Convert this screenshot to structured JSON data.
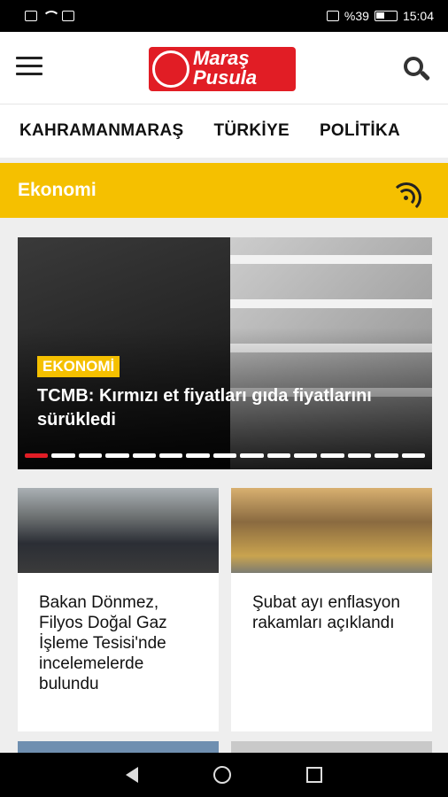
{
  "status_bar": {
    "battery": "%39",
    "time": "15:04"
  },
  "header": {
    "logo_line1": "Maraş",
    "logo_line2": "Pusula"
  },
  "tabs": [
    "KAHRAMANMARAŞ",
    "TÜRKİYE",
    "POLİTİKA"
  ],
  "section": {
    "title": "Ekonomi"
  },
  "hero": {
    "tag": "EKONOMİ",
    "title": "TCMB: Kırmızı et fiyatları gıda fiyatlarını sürükledi",
    "slide_count": 15,
    "active_slide": 1
  },
  "cards": [
    {
      "title": "Bakan Dönmez, Filyos Doğal Gaz İşleme Tesisi'nde incelemelerde bulundu"
    },
    {
      "title": "Şubat ayı enflasyon rakamları açıklandı"
    }
  ]
}
